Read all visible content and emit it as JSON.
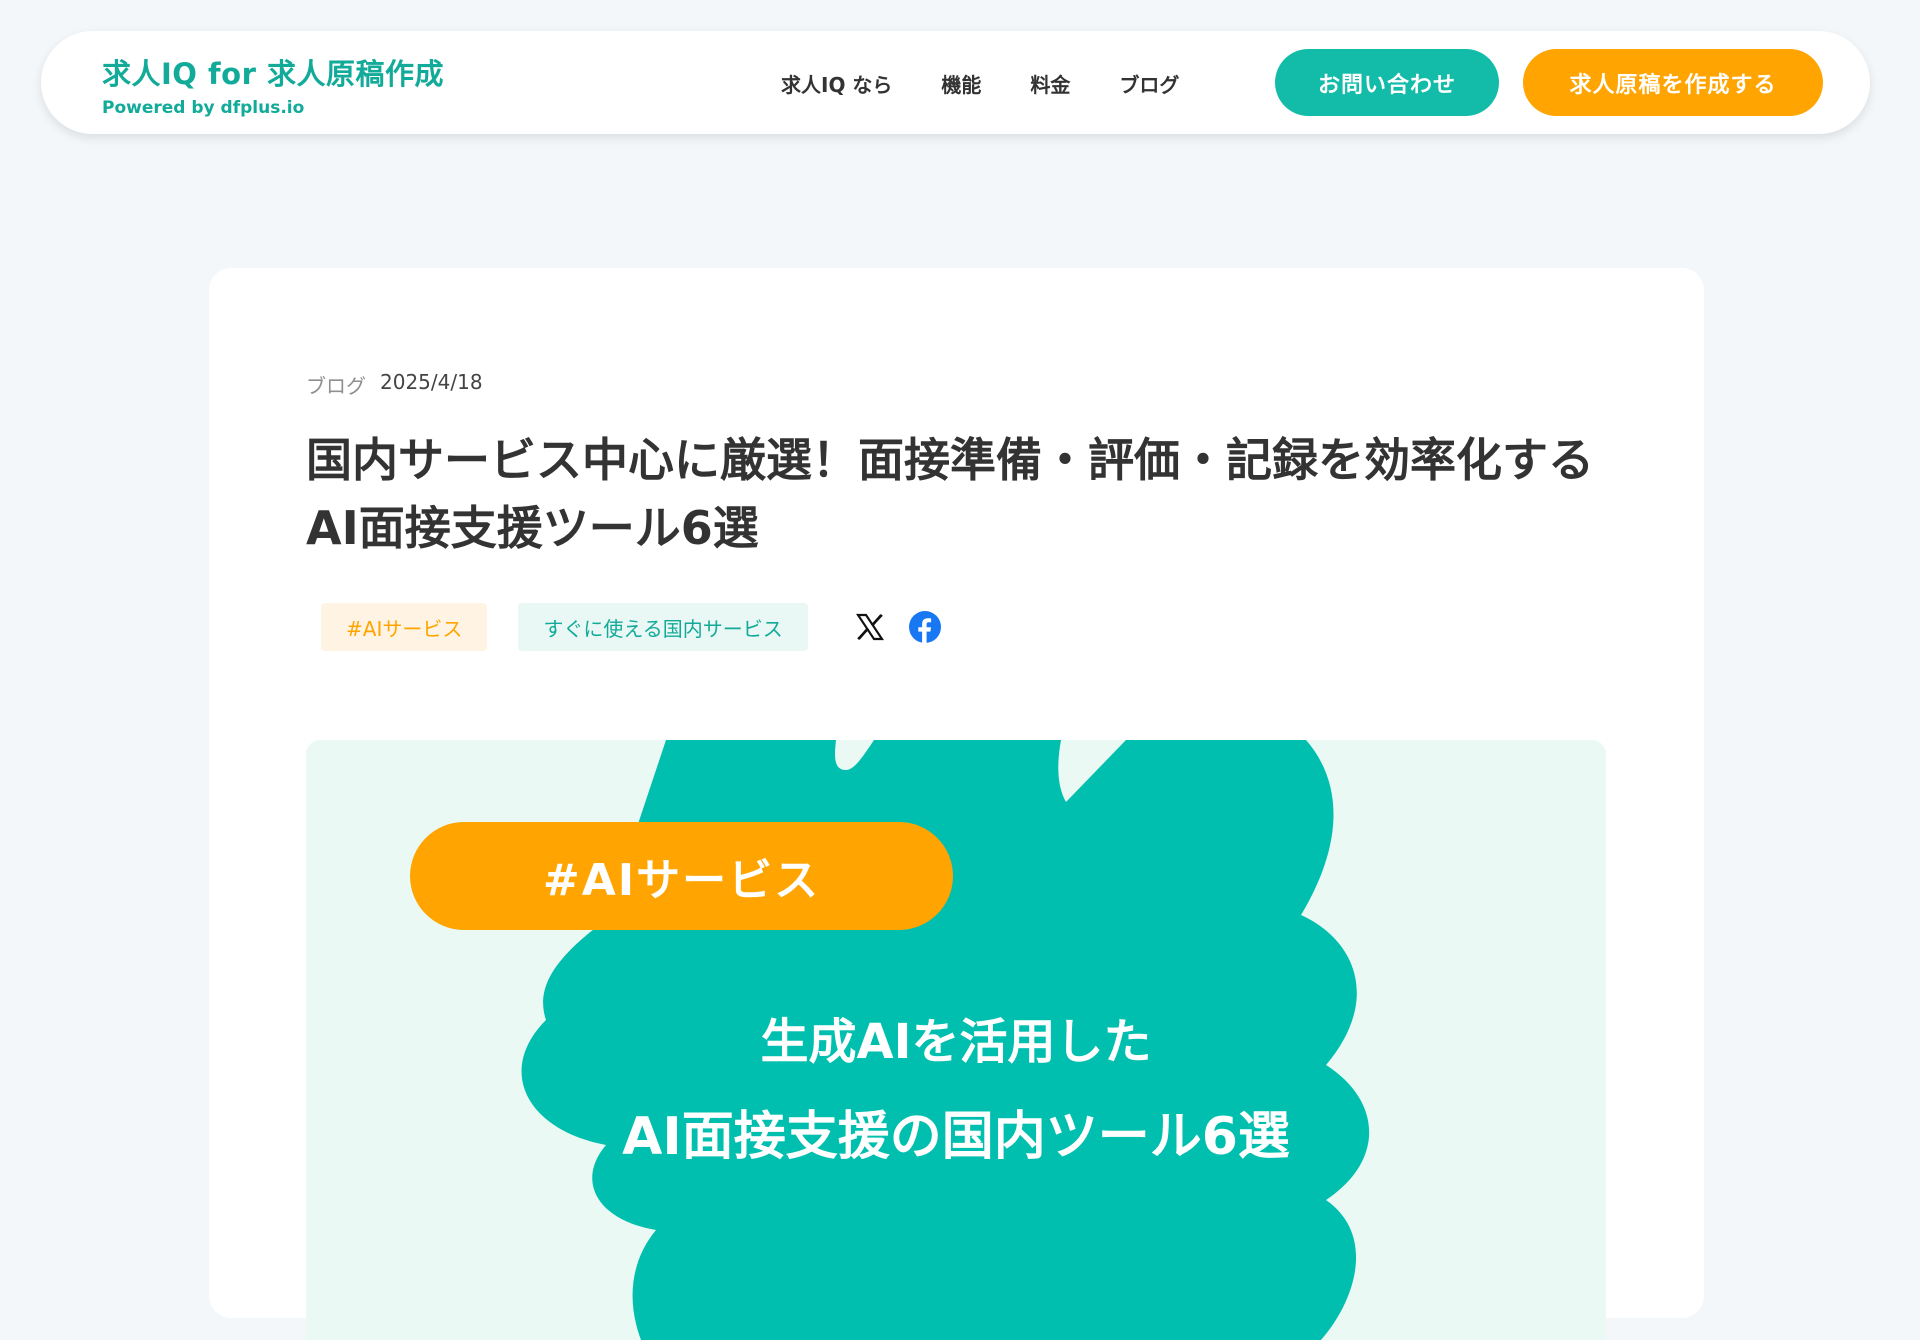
{
  "header": {
    "brand_title": "求人IQ for 求人原稿作成",
    "brand_sub": "Powered by dfplus.io",
    "nav": [
      {
        "label": "求人IQ なら"
      },
      {
        "label": "機能"
      },
      {
        "label": "料金"
      },
      {
        "label": "ブログ"
      }
    ],
    "contact_label": "お問い合わせ",
    "create_label": "求人原稿を作成する"
  },
  "article": {
    "category": "ブログ",
    "date": "2025/4/18",
    "title": "国内サービス中心に厳選！面接準備・評価・記録を効率化するAI面接支援ツール6選",
    "tags": [
      {
        "label": "#AIサービス"
      },
      {
        "label": "すぐに使える国内サービス"
      }
    ],
    "share": {
      "x_icon": "x-logo-icon",
      "facebook_icon": "facebook-logo-icon"
    }
  },
  "hero": {
    "pill": "#AIサービス",
    "line1": "生成AIを活用した",
    "line2": "AI面接支援の国内ツール6選"
  },
  "colors": {
    "brand_teal": "#12aa98",
    "button_teal": "#12bca9",
    "accent_orange": "#ffa400",
    "hero_bg": "#eaf9f3",
    "blob_teal": "#00bfae",
    "facebook_blue": "#1877f2"
  }
}
